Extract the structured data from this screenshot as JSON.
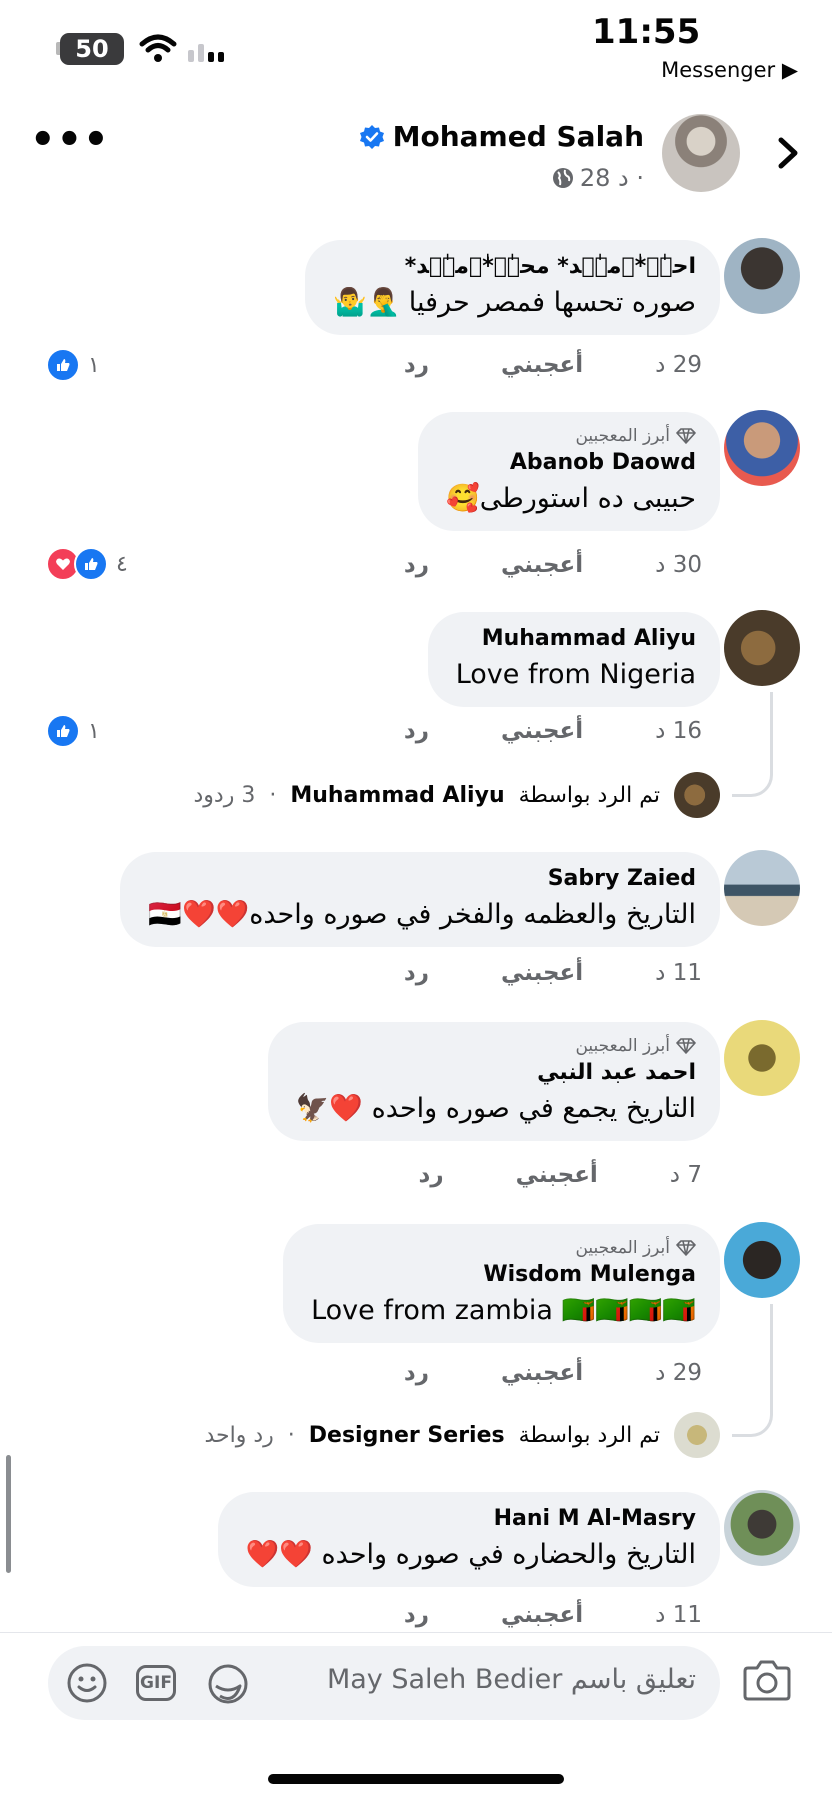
{
  "status": {
    "time": "11:55",
    "back_app": "Messenger ▶",
    "battery": "50"
  },
  "header": {
    "name": "Mohamed Salah",
    "time": "28 د ·"
  },
  "labels": {
    "like": "أعجبني",
    "reply": "رد",
    "top_fan": "أبرز المعجبين",
    "replied_by": "تم الرد بواسطة"
  },
  "comments": [
    {
      "name": "احہٰ۫*ٰ۫مہٰ۫د* محہٰ۫*ٰ۫مہٰ۫د*",
      "text": "صوره تحسها فمصر حرفيا 🤦‍♂️🤷‍♂️",
      "time": "29 د",
      "reaction_count": "١",
      "reactions": [
        "like"
      ]
    },
    {
      "name": "Abanob Daowd",
      "top_fan": true,
      "text": "حبيبى ده استورطى🥰",
      "time": "30 د",
      "reaction_count": "٤",
      "reactions": [
        "like",
        "love"
      ]
    },
    {
      "name": "Muhammad Aliyu",
      "text": "Love from Nigeria",
      "time": "16 د",
      "reaction_count": "١",
      "reactions": [
        "like"
      ],
      "replies": {
        "by": "Muhammad Aliyu",
        "count": "3 ردود"
      }
    },
    {
      "name": "Sabry Zaied",
      "text": "التاريخ والعظمه والفخر في صوره واحده❤️❤️🇪🇬",
      "time": "11 د"
    },
    {
      "name": "احمد عبد النبي",
      "top_fan": true,
      "text": "التاريخ يجمع في صوره واحده ❤️🦅",
      "time": "7 د"
    },
    {
      "name": "Wisdom Mulenga",
      "top_fan": true,
      "text": "Love from zambia 🇿🇲🇿🇲🇿🇲🇿🇲",
      "time": "29 د",
      "replies": {
        "by": "Designer Series",
        "count": "رد واحد"
      }
    },
    {
      "name": "Hani M Al-Masry",
      "text": "التاريخ والحضاره في صوره واحده ❤️❤️",
      "time": "11 د"
    }
  ],
  "composer": {
    "placeholder": "تعليق باسم May Saleh Bedier",
    "gif": "GIF"
  },
  "colors": {
    "like_blue": "#1877f2",
    "love_red": "#f33e58",
    "bubble_gray": "#f0f2f5",
    "meta_gray": "#65676b"
  }
}
